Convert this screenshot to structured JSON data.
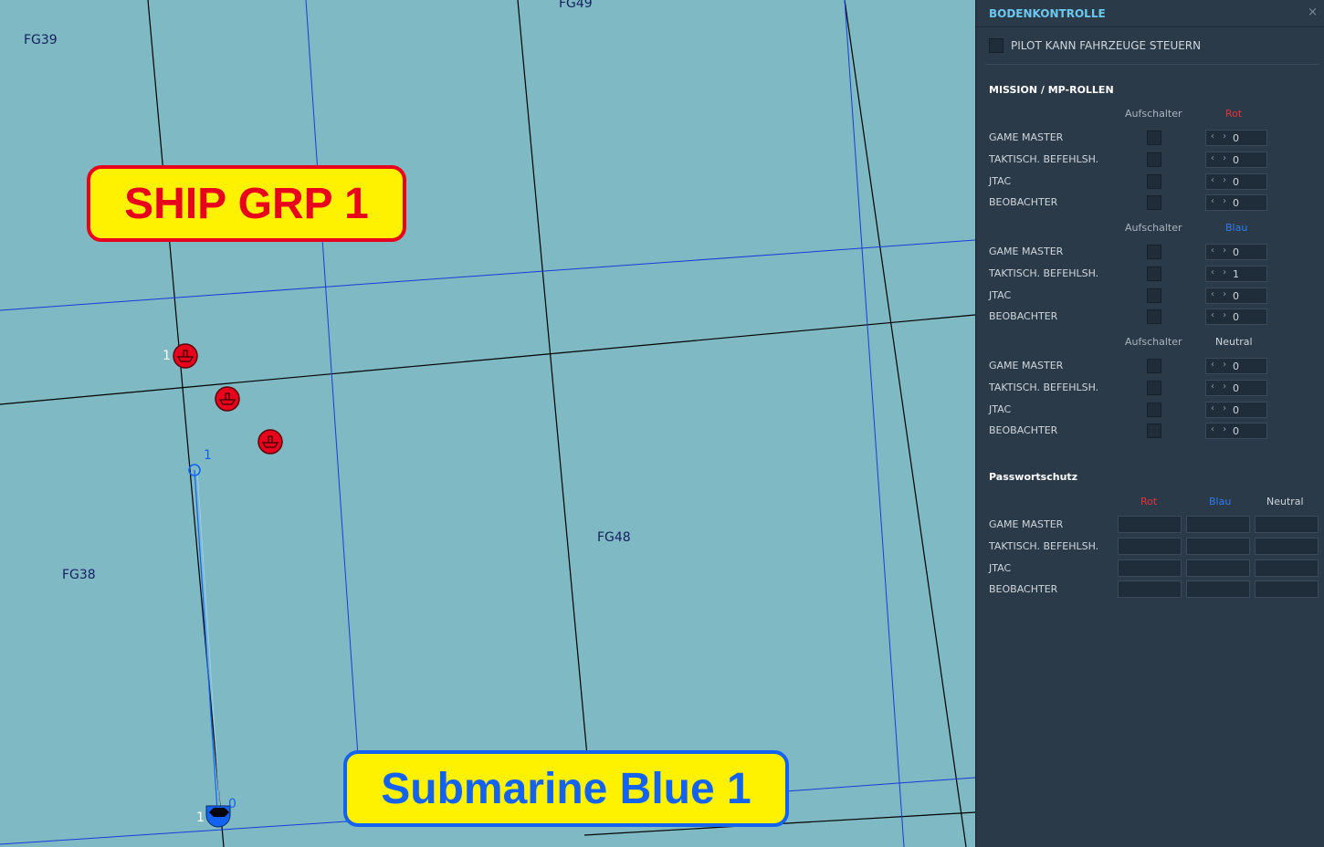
{
  "map": {
    "grid_labels": [
      "FG39",
      "FG49",
      "FG48",
      "FG38"
    ],
    "callouts": {
      "ship_group": "SHIP GRP 1",
      "submarine": "Submarine Blue 1"
    },
    "unit_labels": {
      "ship_lead_number": "1",
      "waypoint_number": "1",
      "sub_number": "1",
      "sub_waypoint_number": "0"
    },
    "colors": {
      "red_coalition": "#e8001c",
      "blue_coalition": "#1463f0",
      "sea": "#7fb9c4"
    }
  },
  "panel": {
    "title": "BODENKONTROLLE",
    "close_icon": "×",
    "pilot_checkbox_label": "PILOT KANN FAHRZEUGE STEUERN",
    "mission_section_title": "MISSION / MP-ROLLEN",
    "aufschalter_label": "Aufschalter",
    "groups": [
      {
        "coalition": "Rot",
        "rows": [
          {
            "role": "GAME MASTER",
            "value": "0"
          },
          {
            "role": "TAKTISCH. BEFEHLSH.",
            "value": "0"
          },
          {
            "role": "JTAC",
            "value": "0"
          },
          {
            "role": "BEOBACHTER",
            "value": "0"
          }
        ]
      },
      {
        "coalition": "Blau",
        "rows": [
          {
            "role": "GAME MASTER",
            "value": "0"
          },
          {
            "role": "TAKTISCH. BEFEHLSH.",
            "value": "1"
          },
          {
            "role": "JTAC",
            "value": "0"
          },
          {
            "role": "BEOBACHTER",
            "value": "0"
          }
        ]
      },
      {
        "coalition": "Neutral",
        "rows": [
          {
            "role": "GAME MASTER",
            "value": "0"
          },
          {
            "role": "TAKTISCH. BEFEHLSH.",
            "value": "0"
          },
          {
            "role": "JTAC",
            "value": "0"
          },
          {
            "role": "BEOBACHTER",
            "value": "0"
          }
        ]
      }
    ],
    "password_section_title": "Passwortschutz",
    "password_columns": [
      "Rot",
      "Blau",
      "Neutral"
    ],
    "password_roles": [
      "GAME MASTER",
      "TAKTISCH. BEFEHLSH.",
      "JTAC",
      "BEOBACHTER"
    ],
    "colors": {
      "rot": "#e8303a",
      "blau": "#2f7bf0",
      "neutral": "#d0d6dc",
      "title": "#6cc8f0",
      "bg": "#2a3a49"
    }
  }
}
